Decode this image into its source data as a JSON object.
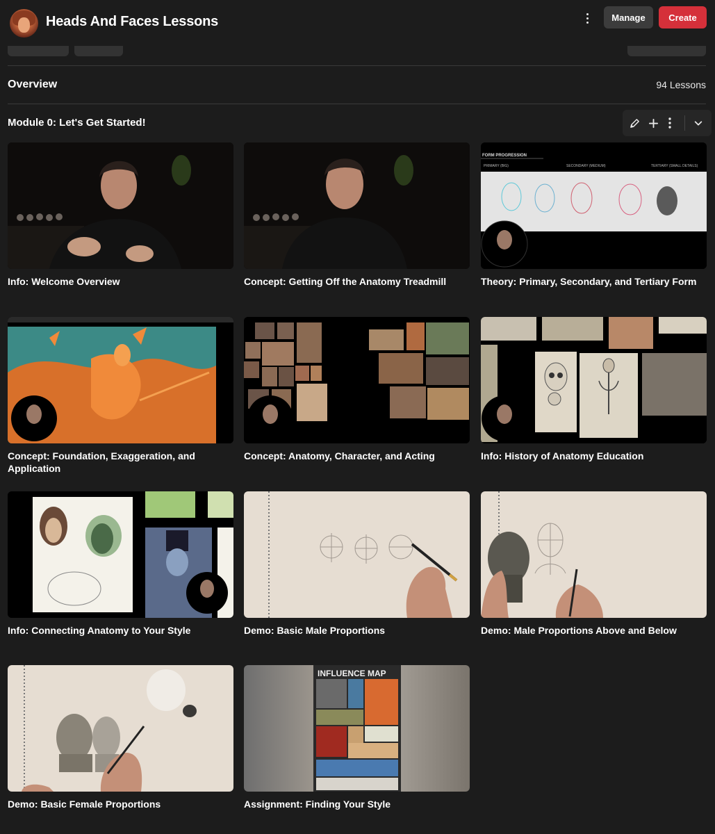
{
  "header": {
    "title": "Heads And Faces Lessons",
    "more_icon": "kebab-menu-icon",
    "manage_label": "Manage",
    "create_label": "Create",
    "create_color": "#d5303a"
  },
  "overview": {
    "label": "Overview",
    "lesson_count": "94 Lessons"
  },
  "module": {
    "title": "Module 0: Let's Get Started!",
    "tools": [
      "pencil-icon",
      "plus-icon",
      "kebab-menu-icon",
      "chevron-down-icon"
    ]
  },
  "lessons": [
    {
      "title": "Info: Welcome Overview"
    },
    {
      "title": "Concept: Getting Off the Anatomy Treadmill"
    },
    {
      "title": "Theory: Primary, Secondary, and Tertiary Form"
    },
    {
      "title": "Concept: Foundation, Exaggeration, and Application"
    },
    {
      "title": "Concept: Anatomy, Character, and Acting"
    },
    {
      "title": "Info: History of Anatomy Education"
    },
    {
      "title": "Info: Connecting Anatomy to Your Style"
    },
    {
      "title": "Demo: Basic Male Proportions"
    },
    {
      "title": "Demo: Male Proportions Above and Below"
    },
    {
      "title": "Demo: Basic Female Proportions"
    },
    {
      "title": "Assignment: Finding Your Style"
    }
  ],
  "thumb_text": {
    "form_progression": "FORM PROGRESSION",
    "primary": "PRIMARY (BIG)",
    "secondary": "SECONDARY (MEDIUM)",
    "tertiary": "TERTIARY (SMALL DETAILS)",
    "influence_map": "INFLUENCE MAP"
  }
}
